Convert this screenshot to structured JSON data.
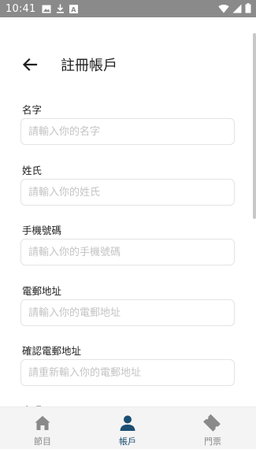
{
  "status_bar": {
    "time": "10:41"
  },
  "app_bar": {
    "title": "註冊帳戶",
    "back_icon": "arrow-left-icon"
  },
  "form": {
    "fields": [
      {
        "label": "名字",
        "placeholder": "請輸入你的名字",
        "value": ""
      },
      {
        "label": "姓氏",
        "placeholder": "請輸入你的姓氏",
        "value": ""
      },
      {
        "label": "手機號碼",
        "placeholder": "請輸入你的手機號碼",
        "value": ""
      },
      {
        "label": "電郵地址",
        "placeholder": "請輸入你的電郵地址",
        "value": ""
      },
      {
        "label": "確認電郵地址",
        "placeholder": "請重新輸入你的電郵地址",
        "value": ""
      },
      {
        "label": "密碼"
      }
    ]
  },
  "bottom_nav": {
    "items": [
      {
        "label": "節目",
        "icon": "home-icon",
        "active": false
      },
      {
        "label": "帳戶",
        "icon": "person-icon",
        "active": true
      },
      {
        "label": "門票",
        "icon": "ticket-icon",
        "active": false
      }
    ]
  },
  "colors": {
    "accent": "#1b4f72",
    "inactive": "#8a8a8a",
    "status_bar": "#8a8a8a"
  }
}
